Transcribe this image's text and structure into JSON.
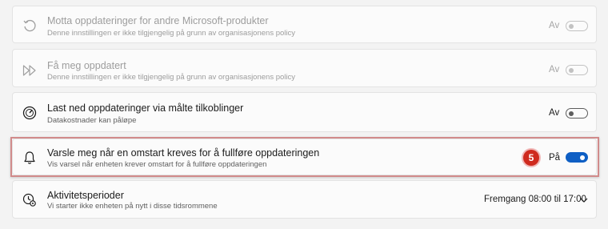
{
  "settings": [
    {
      "title": "Motta oppdateringer for andre Microsoft-produkter",
      "description": "Denne innstillingen er ikke tilgjengelig på grunn av organisasjonens policy",
      "state": "Av",
      "icon": "refresh-icon",
      "enabled": false,
      "on": false
    },
    {
      "title": "Få meg oppdatert",
      "description": "Denne innstillingen er ikke tilgjengelig på grunn av organisasjonens policy",
      "state": "Av",
      "icon": "fast-forward-icon",
      "enabled": false,
      "on": false
    },
    {
      "title": "Last ned oppdateringer via målte tilkoblinger",
      "description": "Datakostnader kan påløpe",
      "state": "Av",
      "icon": "gauge-icon",
      "enabled": true,
      "on": false
    },
    {
      "title": "Varsle meg når en omstart kreves for å fullføre oppdateringen",
      "description": "Vis varsel når enheten krever omstart for å fullføre oppdateringen",
      "state": "På",
      "icon": "bell-icon",
      "enabled": true,
      "on": true
    }
  ],
  "active_hours": {
    "title": "Aktivitetsperioder",
    "description": "Vi starter ikke enheten på nytt i disse tidsrommene",
    "value": "Fremgang 08:00 til 17:00",
    "icon": "clock-gear-icon"
  },
  "step_badge": "5",
  "colors": {
    "accent": "#0f5fc4",
    "highlight_border": "#d18b8b",
    "badge": "#cf2a1e"
  }
}
